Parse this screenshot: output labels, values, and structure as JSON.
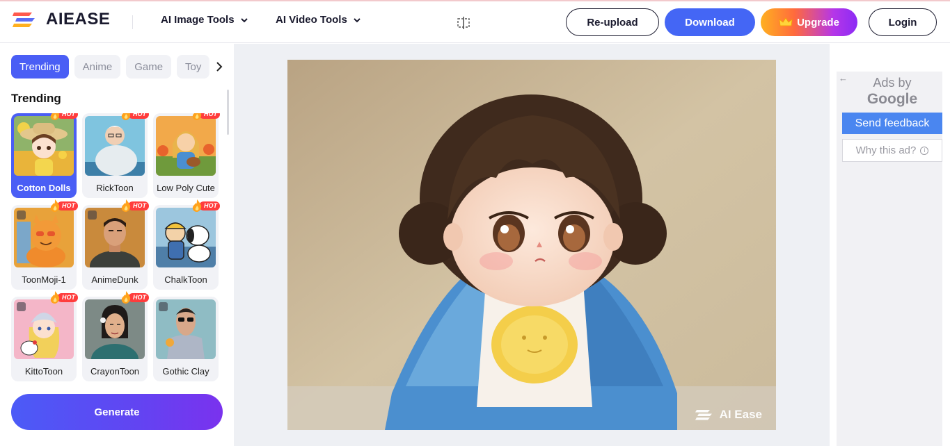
{
  "header": {
    "logo_text": "AIEASE",
    "nav": [
      {
        "label": "AI Image Tools"
      },
      {
        "label": "AI Video Tools"
      }
    ],
    "buttons": {
      "reupload": "Re-upload",
      "download": "Download",
      "upgrade": "Upgrade",
      "login": "Login"
    }
  },
  "sidebar": {
    "tabs": [
      "Trending",
      "Anime",
      "Game",
      "Toy"
    ],
    "active_tab": "Trending",
    "section_title": "Trending",
    "hot_label": "HOT",
    "styles": [
      {
        "label": "Cotton Dolls",
        "hot": true,
        "selected": true,
        "premium": false
      },
      {
        "label": "RickToon",
        "hot": true,
        "selected": false,
        "premium": false
      },
      {
        "label": "Low Poly Cute",
        "hot": true,
        "selected": false,
        "premium": false
      },
      {
        "label": "ToonMoji-1",
        "hot": true,
        "selected": false,
        "premium": true
      },
      {
        "label": "AnimeDunk",
        "hot": true,
        "selected": false,
        "premium": true
      },
      {
        "label": "ChalkToon",
        "hot": true,
        "selected": false,
        "premium": false
      },
      {
        "label": "KittoToon",
        "hot": true,
        "selected": false,
        "premium": true
      },
      {
        "label": "CrayonToon",
        "hot": true,
        "selected": false,
        "premium": false
      },
      {
        "label": "Gothic Clay",
        "hot": false,
        "selected": false,
        "premium": true
      }
    ],
    "generate_label": "Generate"
  },
  "canvas": {
    "watermark": "AI Ease"
  },
  "ads": {
    "ads_by": "Ads by",
    "google": "Google",
    "send_feedback": "Send feedback",
    "why_this_ad": "Why this ad?"
  },
  "colors": {
    "accent": "#4a5ef5",
    "download": "#4466f5",
    "hot": "#ff3c3c"
  }
}
